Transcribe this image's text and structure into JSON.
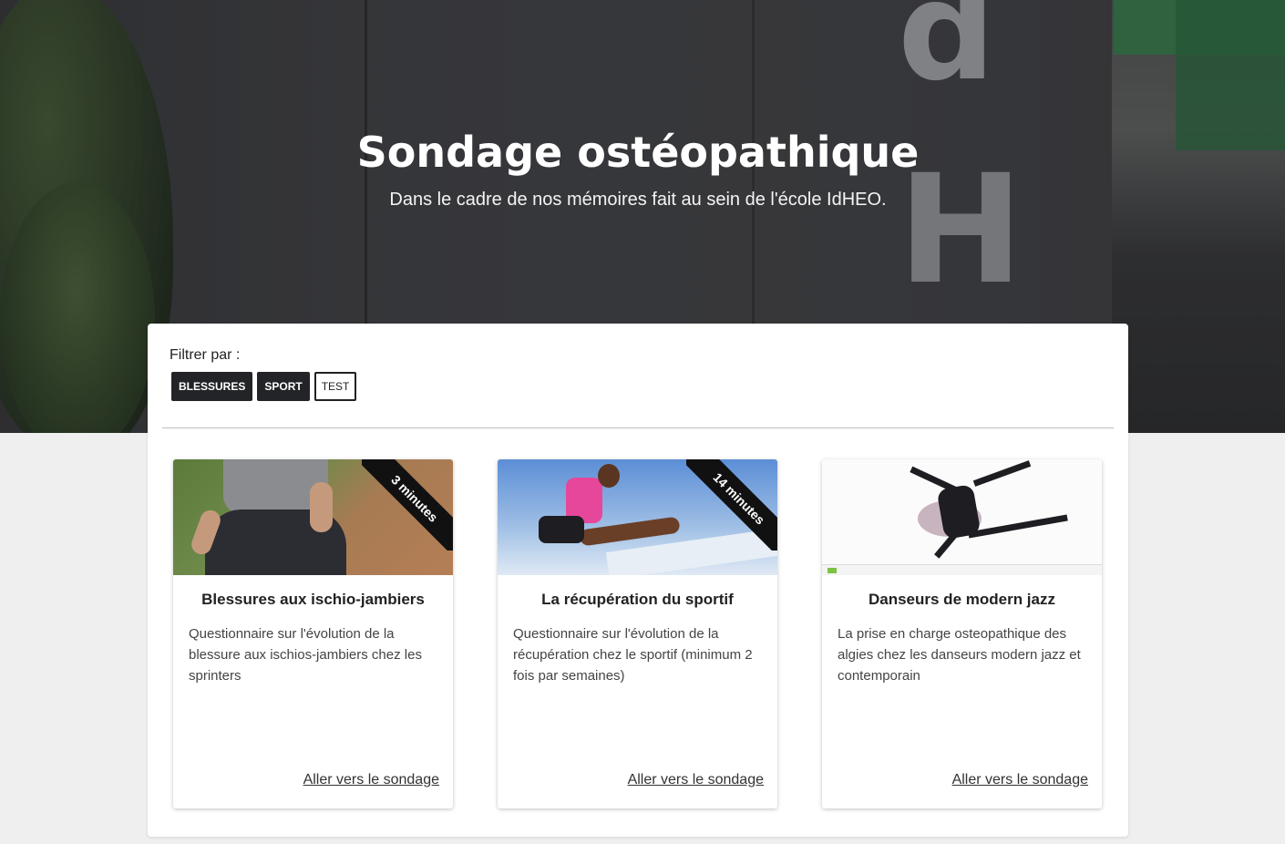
{
  "hero": {
    "title": "Sondage ostéopathique",
    "subtitle": "Dans le cadre de nos mémoires fait au sein de l'école IdHEO."
  },
  "filter": {
    "label": "Filtrer par :",
    "tags": [
      {
        "label": "BLESSURES",
        "active": true
      },
      {
        "label": "SPORT",
        "active": true
      },
      {
        "label": "TEST",
        "active": false
      }
    ]
  },
  "cards": [
    {
      "title": "Blessures aux ischio-jambiers",
      "description": "Questionnaire sur l'évolution de la blessure aux ischios-jambiers chez les sprinters",
      "duration": "3 minutes",
      "link": "Aller vers le sondage"
    },
    {
      "title": "La récupération du sportif",
      "description": "Questionnaire sur l'évolution de la récupération chez le sportif (minimum 2 fois par semaines)",
      "duration": "14 minutes",
      "link": "Aller vers le sondage"
    },
    {
      "title": "Danseurs de modern jazz",
      "description": "La prise en charge osteopathique des algies chez les danseurs modern jazz et contemporain",
      "duration": "",
      "link": "Aller vers le sondage"
    }
  ],
  "colors": {
    "tag_active_bg": "#222428",
    "ribbon_bg": "#111111",
    "hero_accent_green": "#3e8c55"
  }
}
